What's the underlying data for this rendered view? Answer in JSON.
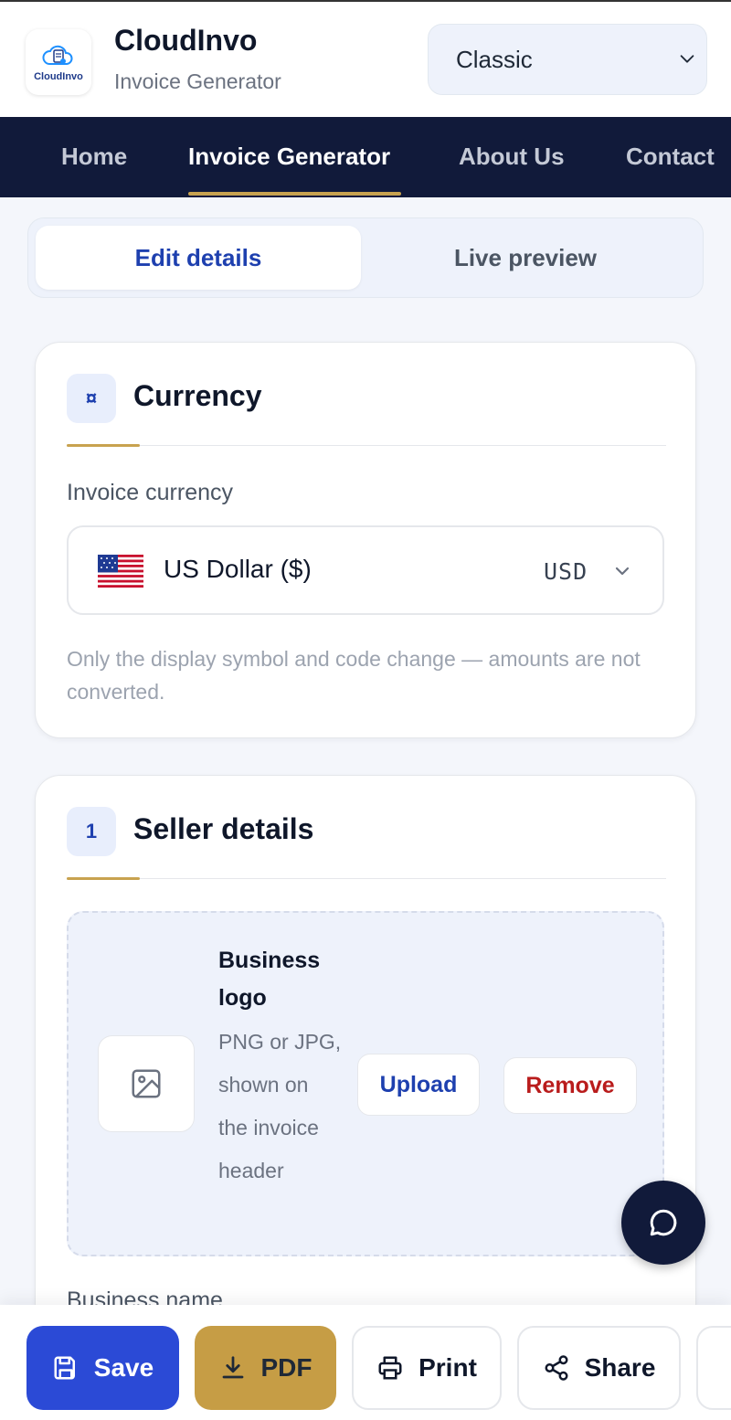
{
  "header": {
    "logo_text": "CloudInvo",
    "brand": "CloudInvo",
    "subtitle": "Invoice Generator",
    "template_select": "Classic"
  },
  "nav": {
    "items": [
      "Home",
      "Invoice Generator",
      "About Us",
      "Contact"
    ],
    "active": "Invoice Generator"
  },
  "tabs": {
    "edit": "Edit details",
    "preview": "Live preview"
  },
  "currency_card": {
    "badge": "¤",
    "title": "Currency",
    "label": "Invoice currency",
    "selected_name": "US Dollar ($)",
    "selected_code": "USD",
    "hint": "Only the display symbol and code change — amounts are not converted."
  },
  "seller_card": {
    "badge": "1",
    "title": "Seller details",
    "logo_title": "Business logo",
    "logo_desc": "PNG or JPG, shown on the invoice header",
    "upload_label": "Upload",
    "remove_label": "Remove",
    "business_name_label": "Business name"
  },
  "actions": {
    "save": "Save",
    "pdf": "PDF",
    "print": "Print",
    "share": "Share"
  },
  "colors": {
    "navy": "#111a3a",
    "accent_blue": "#2b4ad6",
    "gold": "#c69d45",
    "danger": "#b91c1c"
  }
}
